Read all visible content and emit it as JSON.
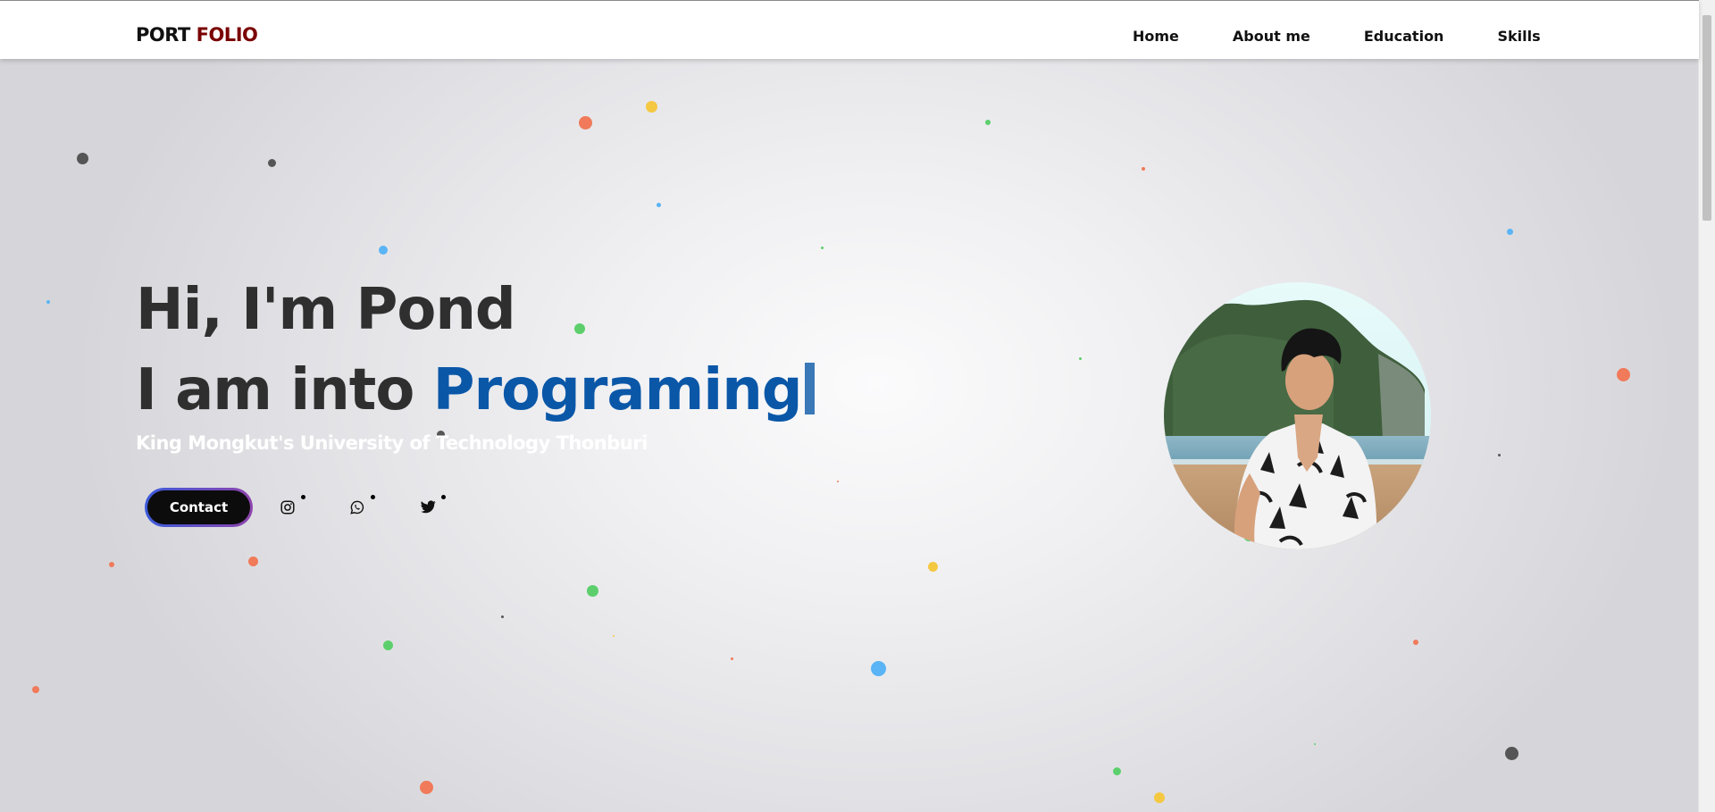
{
  "nav": {
    "logo_part1": "PORT",
    "logo_part2": "FOLIO",
    "links": [
      "Home",
      "About me",
      "Education",
      "Skills"
    ]
  },
  "hero": {
    "greeting": "Hi, I'm Pond",
    "line2_prefix": "I am into",
    "typed_word": "Programing",
    "subtitle": "King Mongkut's University of Technology Thonburi",
    "contact_label": "Contact"
  },
  "social": [
    "instagram-icon",
    "whatsapp-icon",
    "twitter-icon"
  ],
  "colors": {
    "accent_blue": "#0a57a8",
    "logo_red": "#7a0000",
    "heading": "#2f2f2f",
    "confetti": [
      "#f07a5a",
      "#f5c842",
      "#5ccf6c",
      "#5ab4f5",
      "#555555"
    ]
  }
}
